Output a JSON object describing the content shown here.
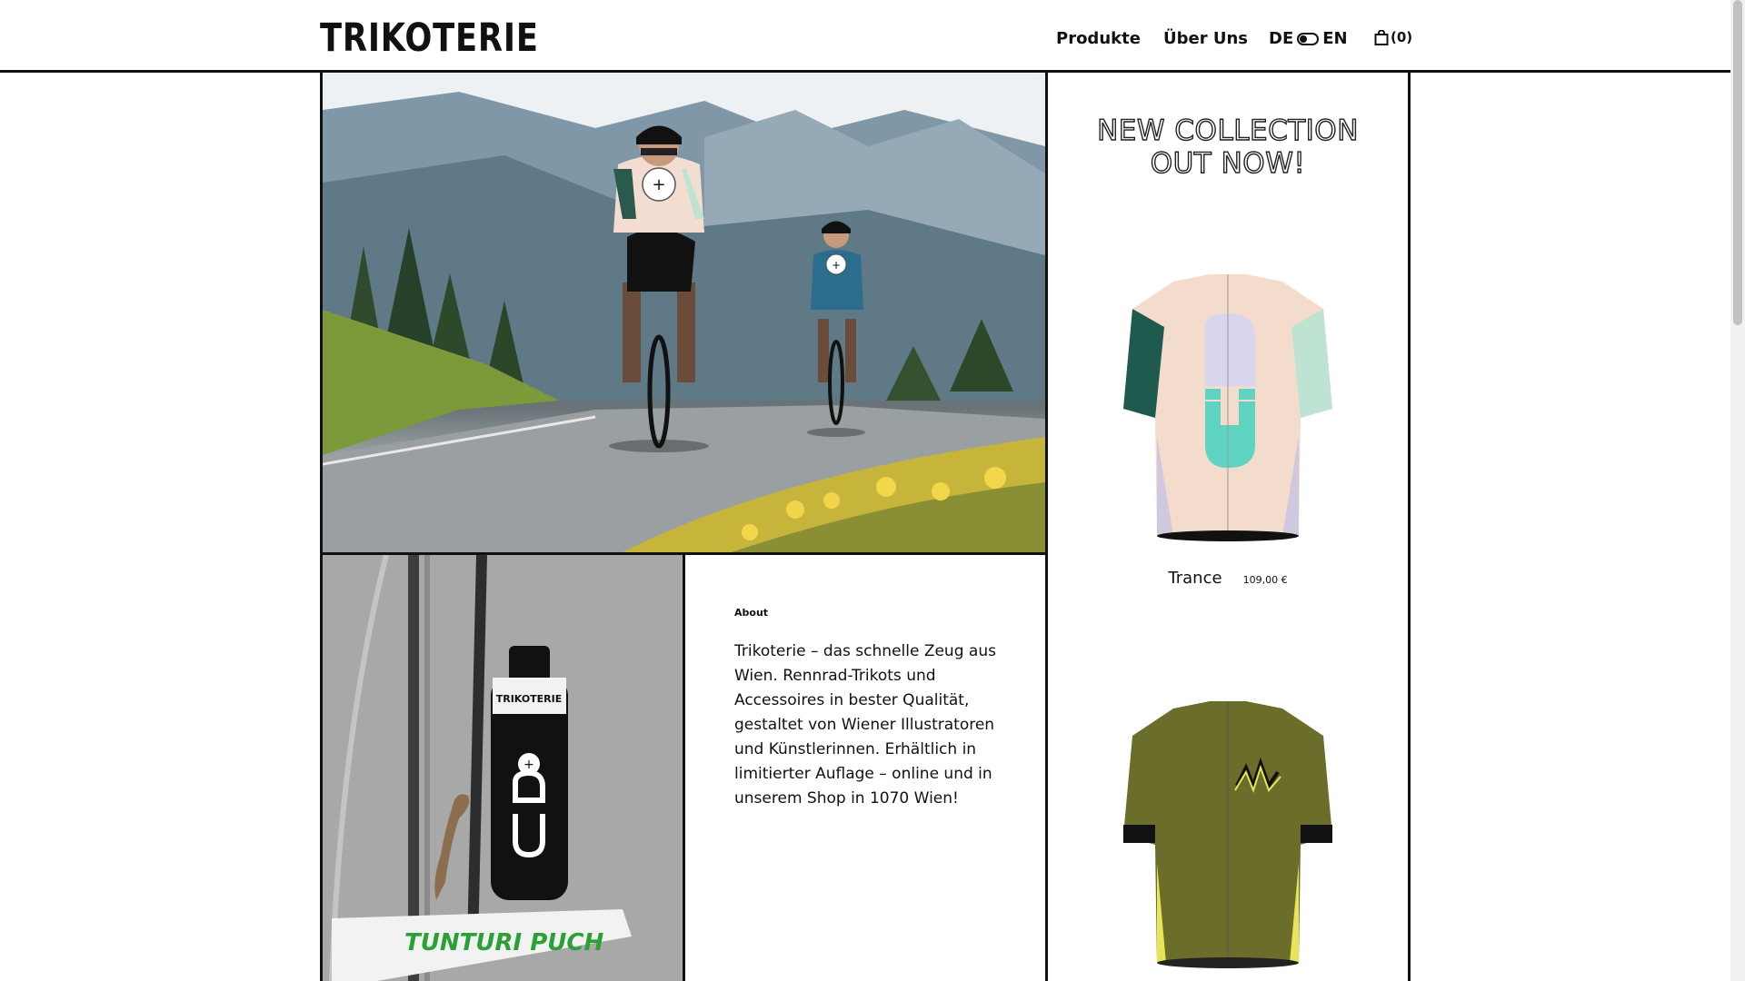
{
  "header": {
    "logo": "TRIKOTERIE",
    "nav": {
      "produkte": "Produkte",
      "ueber_uns": "Über Uns"
    },
    "lang": {
      "de": "DE",
      "en": "EN"
    },
    "cart_count": "(0)"
  },
  "about": {
    "label": "About",
    "text": "Trikoterie – das schnelle Zeug aus Wien. Rennrad-Trikots und Accessoires in bester Qualität, gestaltet von Wiener Illustratoren und Künstlerinnen. Erhältlich in limitierter Auflage – online und in unserem Shop in 1070 Wien!"
  },
  "collection": {
    "title_line1": "NEW COLLECTION",
    "title_line2": "OUT NOW!"
  },
  "products": [
    {
      "name": "Trance",
      "price": "109,00 €",
      "colors": {
        "body": "#f3dccb",
        "sleeve_left": "#1f5a4e",
        "sleeve_right": "#bfe3d3",
        "logo": "#5fd3c2"
      }
    },
    {
      "name": "",
      "price": "",
      "colors": {
        "body": "#6b6d2a",
        "accent": "#e8e45a"
      }
    }
  ],
  "bottle": {
    "brand_text": "TRIKOTERIE",
    "stand_text": "TUNTURI PUCH"
  },
  "icons": {
    "cart": "shopping-bag-icon",
    "toggle": "language-toggle-icon"
  }
}
